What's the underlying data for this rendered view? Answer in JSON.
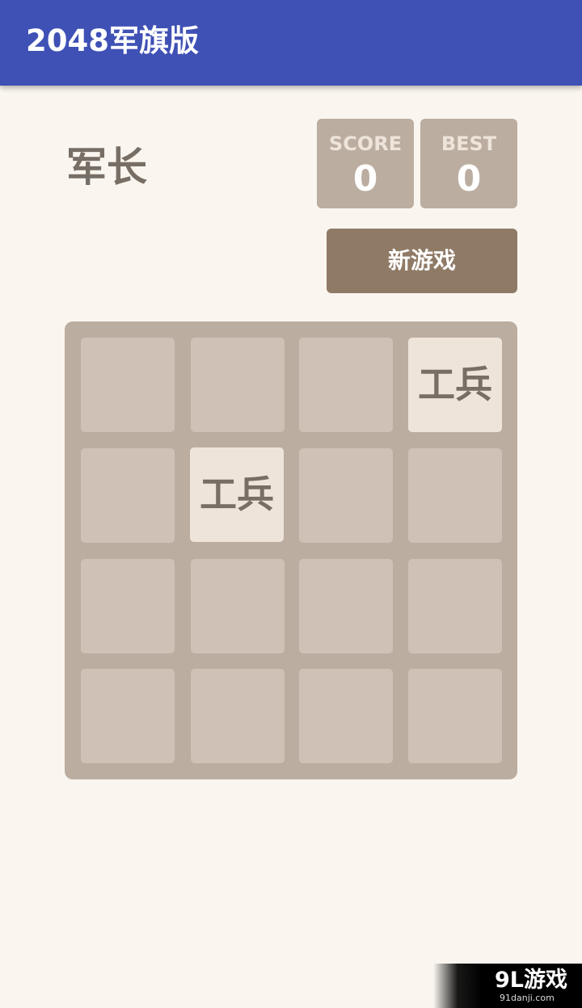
{
  "app_bar": {
    "title": "2048军旗版",
    "color": "#3f51b5"
  },
  "game": {
    "rank_title": "军长",
    "score": {
      "label": "SCORE",
      "value": "0"
    },
    "best": {
      "label": "BEST",
      "value": "0"
    },
    "new_game_label": "新游戏",
    "board": {
      "rows": [
        [
          "",
          "",
          "",
          "工兵"
        ],
        [
          "",
          "工兵",
          "",
          ""
        ],
        [
          "",
          "",
          "",
          ""
        ],
        [
          "",
          "",
          "",
          ""
        ]
      ]
    }
  },
  "colors": {
    "background": "#faf6ef",
    "board": "#bbada0",
    "empty_cell": "#cfc1b5",
    "filled_tile": "#eee4da",
    "tile_text": "#776e65",
    "button": "#8f7a66"
  },
  "watermark": {
    "logo": "9L游戏",
    "url": "91danji.com"
  }
}
